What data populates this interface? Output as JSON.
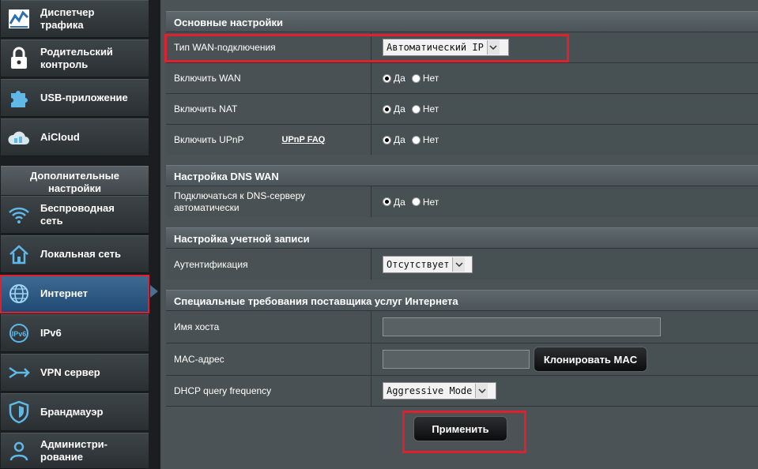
{
  "sidebar": {
    "top_items": [
      {
        "label_line1": "Диспетчер",
        "label_line2": "трафика",
        "icon": "traffic-icon"
      },
      {
        "label_line1": "Родительский",
        "label_line2": "контроль",
        "icon": "lock-icon"
      },
      {
        "label_line1": "USB-приложение",
        "label_line2": "",
        "icon": "puzzle-icon"
      },
      {
        "label_line1": "AiCloud",
        "label_line2": "",
        "icon": "cloud-icon"
      }
    ],
    "section_title_line1": "Дополнительные",
    "section_title_line2": "настройки",
    "advanced_items": [
      {
        "label_line1": "Беспроводная",
        "label_line2": "сеть",
        "icon": "wifi-icon"
      },
      {
        "label_line1": "Локальная сеть",
        "label_line2": "",
        "icon": "home-icon"
      },
      {
        "label_line1": "Интернет",
        "label_line2": "",
        "icon": "globe-icon"
      },
      {
        "label_line1": "IPv6",
        "label_line2": "",
        "icon": "ipv6-icon"
      },
      {
        "label_line1": "VPN сервер",
        "label_line2": "",
        "icon": "vpn-icon"
      },
      {
        "label_line1": "Брандмауэр",
        "label_line2": "",
        "icon": "shield-icon"
      },
      {
        "label_line1": "Администри-",
        "label_line2": "рование",
        "icon": "admin-icon"
      }
    ]
  },
  "basic": {
    "title": "Основные настройки",
    "wan_type_label": "Тип WAN-подключения",
    "wan_type_value": "Автоматический IP",
    "enable_wan_label": "Включить WAN",
    "enable_nat_label": "Включить NAT",
    "enable_upnp_label": "Включить UPnP",
    "upnp_faq": "UPnP FAQ"
  },
  "radio": {
    "yes": "Да",
    "no": "Нет"
  },
  "dns": {
    "title": "Настройка DNS WAN",
    "auto_label_line1": "Подключаться к DNS-серверу",
    "auto_label_line2": "автоматически"
  },
  "account": {
    "title": "Настройка учетной записи",
    "auth_label": "Аутентификация",
    "auth_value": "Отсутствует"
  },
  "isp": {
    "title": "Специальные требования поставщика услуг Интернета",
    "hostname_label": "Имя хоста",
    "hostname_value": "",
    "mac_label": "MAC-адрес",
    "mac_value": "",
    "clone_mac": "Клонировать MAC",
    "dhcp_label": "DHCP query frequency",
    "dhcp_value": "Aggressive Mode"
  },
  "apply": "Применить",
  "colors": {
    "accent": "#204a74",
    "highlight": "#e0212d"
  }
}
